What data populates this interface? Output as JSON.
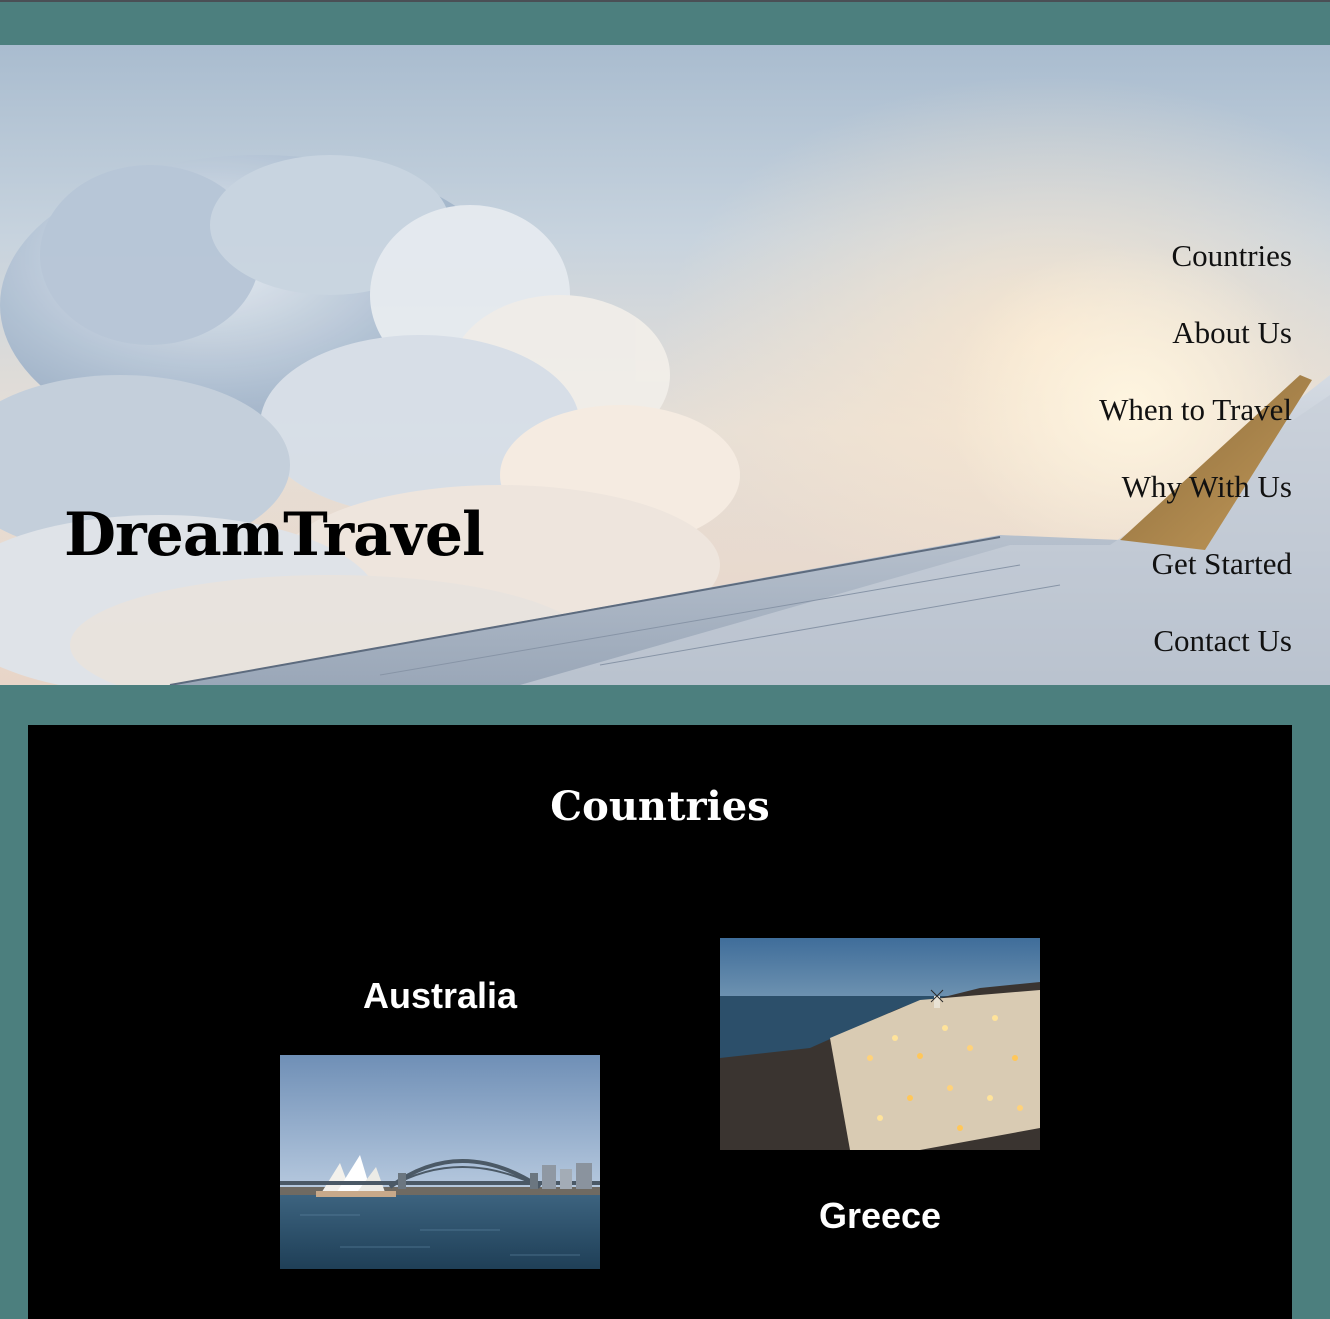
{
  "header": {
    "brand": "DreamTravel"
  },
  "nav": {
    "items": [
      {
        "label": "Countries"
      },
      {
        "label": "About Us"
      },
      {
        "label": "When to Travel"
      },
      {
        "label": "Why With Us"
      },
      {
        "label": "Get Started"
      },
      {
        "label": "Contact Us"
      }
    ]
  },
  "countries_section": {
    "title": "Countries",
    "cards": [
      {
        "name": "Australia"
      },
      {
        "name": "Greece"
      }
    ]
  },
  "colors": {
    "page_background": "#4c7f7e",
    "panel_background": "#000000",
    "panel_text": "#ffffff",
    "hero_text": "#000000"
  }
}
